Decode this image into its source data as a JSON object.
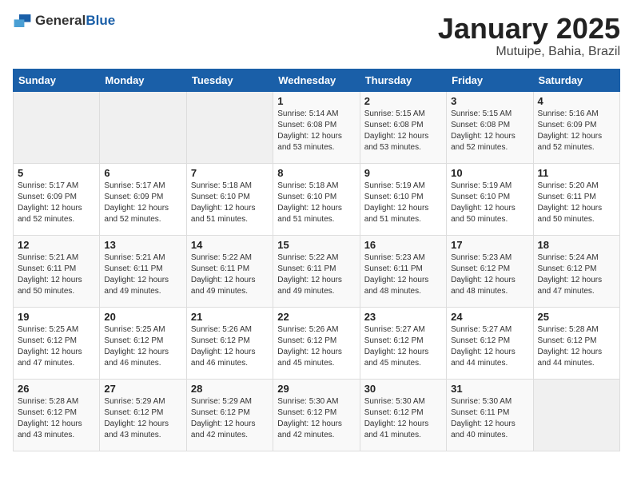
{
  "logo": {
    "general": "General",
    "blue": "Blue"
  },
  "header": {
    "month": "January 2025",
    "location": "Mutuipe, Bahia, Brazil"
  },
  "weekdays": [
    "Sunday",
    "Monday",
    "Tuesday",
    "Wednesday",
    "Thursday",
    "Friday",
    "Saturday"
  ],
  "weeks": [
    [
      {
        "day": "",
        "info": ""
      },
      {
        "day": "",
        "info": ""
      },
      {
        "day": "",
        "info": ""
      },
      {
        "day": "1",
        "info": "Sunrise: 5:14 AM\nSunset: 6:08 PM\nDaylight: 12 hours\nand 53 minutes."
      },
      {
        "day": "2",
        "info": "Sunrise: 5:15 AM\nSunset: 6:08 PM\nDaylight: 12 hours\nand 53 minutes."
      },
      {
        "day": "3",
        "info": "Sunrise: 5:15 AM\nSunset: 6:08 PM\nDaylight: 12 hours\nand 52 minutes."
      },
      {
        "day": "4",
        "info": "Sunrise: 5:16 AM\nSunset: 6:09 PM\nDaylight: 12 hours\nand 52 minutes."
      }
    ],
    [
      {
        "day": "5",
        "info": "Sunrise: 5:17 AM\nSunset: 6:09 PM\nDaylight: 12 hours\nand 52 minutes."
      },
      {
        "day": "6",
        "info": "Sunrise: 5:17 AM\nSunset: 6:09 PM\nDaylight: 12 hours\nand 52 minutes."
      },
      {
        "day": "7",
        "info": "Sunrise: 5:18 AM\nSunset: 6:10 PM\nDaylight: 12 hours\nand 51 minutes."
      },
      {
        "day": "8",
        "info": "Sunrise: 5:18 AM\nSunset: 6:10 PM\nDaylight: 12 hours\nand 51 minutes."
      },
      {
        "day": "9",
        "info": "Sunrise: 5:19 AM\nSunset: 6:10 PM\nDaylight: 12 hours\nand 51 minutes."
      },
      {
        "day": "10",
        "info": "Sunrise: 5:19 AM\nSunset: 6:10 PM\nDaylight: 12 hours\nand 50 minutes."
      },
      {
        "day": "11",
        "info": "Sunrise: 5:20 AM\nSunset: 6:11 PM\nDaylight: 12 hours\nand 50 minutes."
      }
    ],
    [
      {
        "day": "12",
        "info": "Sunrise: 5:21 AM\nSunset: 6:11 PM\nDaylight: 12 hours\nand 50 minutes."
      },
      {
        "day": "13",
        "info": "Sunrise: 5:21 AM\nSunset: 6:11 PM\nDaylight: 12 hours\nand 49 minutes."
      },
      {
        "day": "14",
        "info": "Sunrise: 5:22 AM\nSunset: 6:11 PM\nDaylight: 12 hours\nand 49 minutes."
      },
      {
        "day": "15",
        "info": "Sunrise: 5:22 AM\nSunset: 6:11 PM\nDaylight: 12 hours\nand 49 minutes."
      },
      {
        "day": "16",
        "info": "Sunrise: 5:23 AM\nSunset: 6:11 PM\nDaylight: 12 hours\nand 48 minutes."
      },
      {
        "day": "17",
        "info": "Sunrise: 5:23 AM\nSunset: 6:12 PM\nDaylight: 12 hours\nand 48 minutes."
      },
      {
        "day": "18",
        "info": "Sunrise: 5:24 AM\nSunset: 6:12 PM\nDaylight: 12 hours\nand 47 minutes."
      }
    ],
    [
      {
        "day": "19",
        "info": "Sunrise: 5:25 AM\nSunset: 6:12 PM\nDaylight: 12 hours\nand 47 minutes."
      },
      {
        "day": "20",
        "info": "Sunrise: 5:25 AM\nSunset: 6:12 PM\nDaylight: 12 hours\nand 46 minutes."
      },
      {
        "day": "21",
        "info": "Sunrise: 5:26 AM\nSunset: 6:12 PM\nDaylight: 12 hours\nand 46 minutes."
      },
      {
        "day": "22",
        "info": "Sunrise: 5:26 AM\nSunset: 6:12 PM\nDaylight: 12 hours\nand 45 minutes."
      },
      {
        "day": "23",
        "info": "Sunrise: 5:27 AM\nSunset: 6:12 PM\nDaylight: 12 hours\nand 45 minutes."
      },
      {
        "day": "24",
        "info": "Sunrise: 5:27 AM\nSunset: 6:12 PM\nDaylight: 12 hours\nand 44 minutes."
      },
      {
        "day": "25",
        "info": "Sunrise: 5:28 AM\nSunset: 6:12 PM\nDaylight: 12 hours\nand 44 minutes."
      }
    ],
    [
      {
        "day": "26",
        "info": "Sunrise: 5:28 AM\nSunset: 6:12 PM\nDaylight: 12 hours\nand 43 minutes."
      },
      {
        "day": "27",
        "info": "Sunrise: 5:29 AM\nSunset: 6:12 PM\nDaylight: 12 hours\nand 43 minutes."
      },
      {
        "day": "28",
        "info": "Sunrise: 5:29 AM\nSunset: 6:12 PM\nDaylight: 12 hours\nand 42 minutes."
      },
      {
        "day": "29",
        "info": "Sunrise: 5:30 AM\nSunset: 6:12 PM\nDaylight: 12 hours\nand 42 minutes."
      },
      {
        "day": "30",
        "info": "Sunrise: 5:30 AM\nSunset: 6:12 PM\nDaylight: 12 hours\nand 41 minutes."
      },
      {
        "day": "31",
        "info": "Sunrise: 5:30 AM\nSunset: 6:11 PM\nDaylight: 12 hours\nand 40 minutes."
      },
      {
        "day": "",
        "info": ""
      }
    ]
  ]
}
